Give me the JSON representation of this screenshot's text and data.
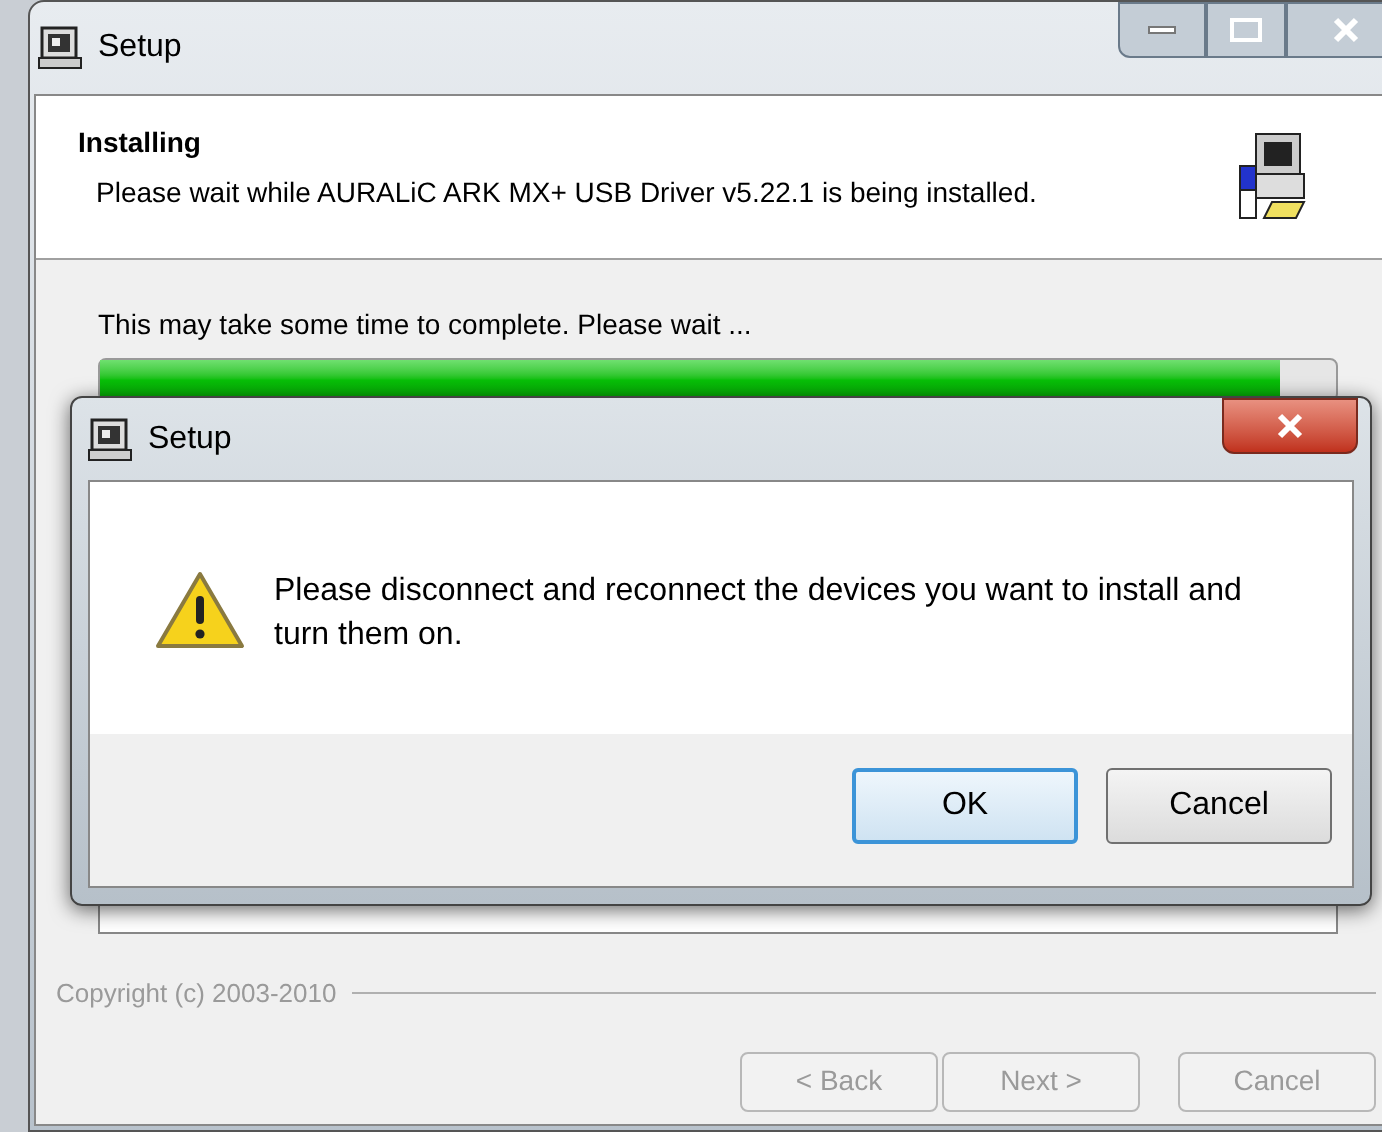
{
  "window": {
    "title": "Setup"
  },
  "header": {
    "title": "Installing",
    "subtitle": "Please wait while AURALiC ARK MX+ USB Driver v5.22.1 is being installed."
  },
  "status": "This may take some time to complete. Please wait ...",
  "progress": {
    "level": 0.955
  },
  "copyright": "Copyright (c) 2003-2010",
  "buttons": [
    {
      "label": "< Back",
      "disabled": true
    },
    {
      "label": "Next >",
      "disabled": true
    },
    {
      "label": "Cancel",
      "disabled": true
    }
  ],
  "dialog": {
    "title": "Setup",
    "message": "Please disconnect and reconnect the devices you want to install and turn them on.",
    "buttons": [
      {
        "label": "OK",
        "selected": true
      },
      {
        "label": "Cancel",
        "selected": false
      }
    ]
  }
}
